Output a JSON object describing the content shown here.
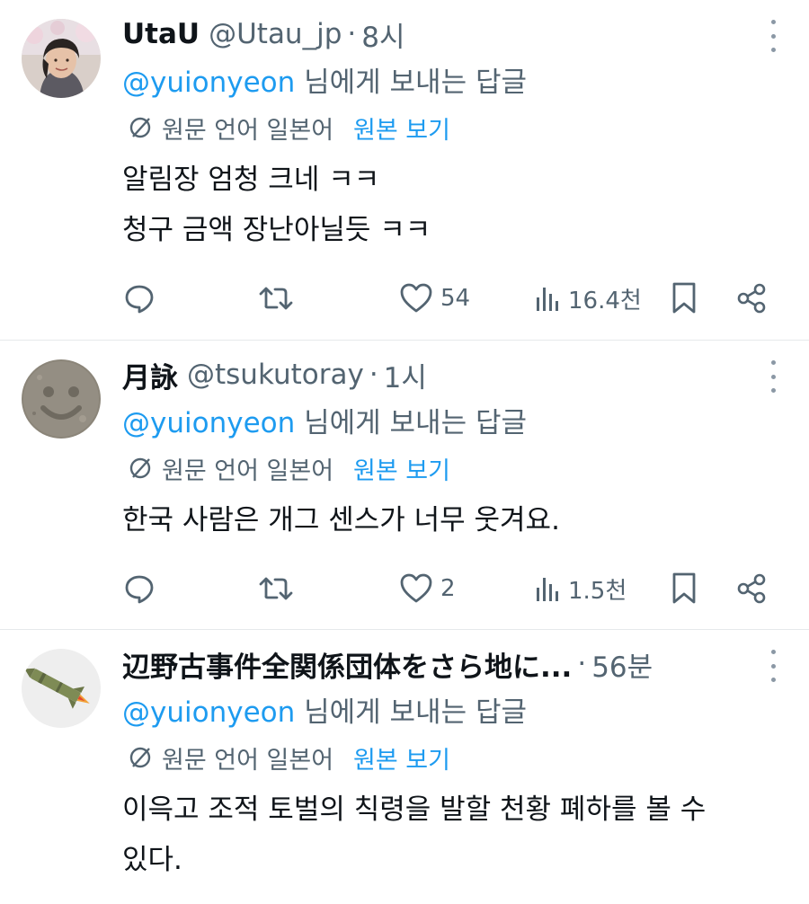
{
  "translation": {
    "lang_label": "원문 언어 일본어",
    "show_original": "원본 보기"
  },
  "reply_text": "님에게 보내는 답글",
  "tweets": [
    {
      "name": "UtaU",
      "handle": "@Utau_jp",
      "dot": "·",
      "time": "8시",
      "reply_to": "@yuionyeon",
      "lines": [
        "알림장 엄청 크네 ㅋㅋ",
        "청구 금액 장난아닐듯 ㅋㅋ"
      ],
      "likes": "54",
      "views": "16.4천"
    },
    {
      "name": "月詠",
      "handle": "@tsukutoray",
      "dot": "·",
      "time": "1시",
      "reply_to": "@yuionyeon",
      "lines": [
        "한국 사람은 개그 센스가 너무 웃겨요."
      ],
      "likes": "2",
      "views": "1.5천"
    },
    {
      "name": "辺野古事件全関係団体をさら地に...",
      "dot": "·",
      "time": "56분",
      "reply_to": "@yuionyeon",
      "lines": [
        "이윽고 조적 토벌의 칙령을 발할 천황 폐하를 볼 수",
        "있다."
      ]
    }
  ],
  "colors": {
    "text": "#0f1419",
    "secondary": "#536471",
    "link": "#1d9bf0",
    "divider": "#e6e9eb"
  },
  "icons": [
    "reply-icon",
    "retweet-icon",
    "like-icon",
    "views-icon",
    "bookmark-icon",
    "share-icon",
    "translate-icon",
    "more-icon"
  ]
}
